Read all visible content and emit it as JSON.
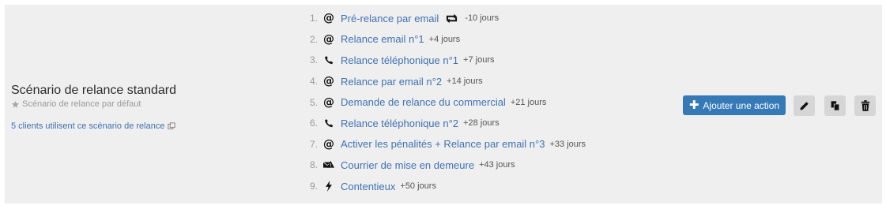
{
  "scenario": {
    "title": "Scénario de relance standard",
    "default_label": "Scénario de relance par défaut",
    "clients_link": "5 clients utilisent ce scénario de relance"
  },
  "steps": [
    {
      "num": "1.",
      "icon": "at-icon",
      "label": "Pré-relance par email",
      "repeat": true,
      "offset": "-10 jours"
    },
    {
      "num": "2.",
      "icon": "at-icon",
      "label": "Relance email n°1",
      "offset": "+4 jours"
    },
    {
      "num": "3.",
      "icon": "phone-icon",
      "label": "Relance téléphonique n°1",
      "offset": "+7 jours"
    },
    {
      "num": "4.",
      "icon": "at-icon",
      "label": "Relance par email n°2",
      "offset": "+14 jours"
    },
    {
      "num": "5.",
      "icon": "at-icon",
      "label": "Demande de relance du commercial",
      "offset": "+21 jours"
    },
    {
      "num": "6.",
      "icon": "phone-icon",
      "label": "Relance téléphonique n°2",
      "offset": "+28 jours"
    },
    {
      "num": "7.",
      "icon": "at-icon",
      "label": "Activer les pénalités + Relance par email n°3",
      "offset": "+33 jours"
    },
    {
      "num": "8.",
      "icon": "mail-warning-icon",
      "label": "Courrier de mise en demeure",
      "offset": "+43 jours"
    },
    {
      "num": "9.",
      "icon": "lightning-icon",
      "label": "Contentieux",
      "offset": "+50 jours"
    }
  ],
  "actions": {
    "add_label": "Ajouter une action",
    "edit_icon": "pencil-icon",
    "copy_icon": "copy-icon",
    "delete_icon": "trash-icon"
  },
  "colors": {
    "panel_bg": "#efefef",
    "link": "#3f72b3",
    "primary_button": "#3579b6",
    "icon_button": "#d6d6d6"
  }
}
